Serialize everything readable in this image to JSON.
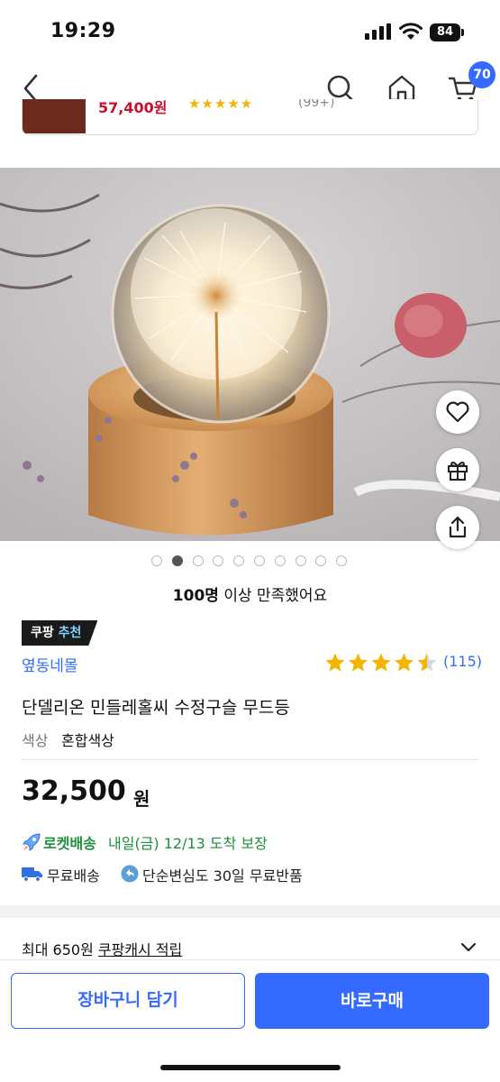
{
  "status_bar": {
    "time": "19:29",
    "battery": "84"
  },
  "nav": {
    "cart_count": "70"
  },
  "sticky": {
    "price": "57,400원",
    "stars": "★★★★★",
    "count": "(99+)"
  },
  "carousel": {
    "total": 10,
    "active_index": 1
  },
  "satisfaction": {
    "bold": "100명",
    "rest": " 이상 만족했어요"
  },
  "badge": {
    "brand": "쿠팡",
    "label": "추천"
  },
  "seller": "옆동네몰",
  "rating": {
    "value": 4.5,
    "count": "(115)"
  },
  "product": {
    "title": "단델리온 민들레홀씨 수정구슬 무드등",
    "option_label": "색상",
    "option_value": "혼합색상",
    "price": "32,500",
    "price_unit": "원"
  },
  "delivery": {
    "rocket_label": "로켓배송",
    "rocket_date": "내일(금) 12/13 도착 보장",
    "free_shipping": "무료배송",
    "free_return": "단순변심도 30일 무료반품"
  },
  "cash": {
    "prefix": "최대 650원 ",
    "link": "쿠팡캐시 적립"
  },
  "actions": {
    "add_to_cart": "장바구니 담기",
    "buy_now": "바로구매"
  },
  "colors": {
    "accent": "#346aff",
    "rocket_green": "#1e8f3c",
    "star": "#f5b400"
  }
}
